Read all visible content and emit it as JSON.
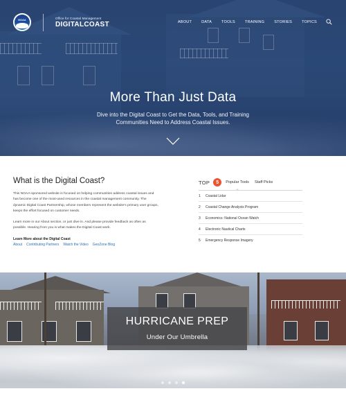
{
  "header": {
    "logo_text": "NOAA",
    "brand_sub": "Office for Coastal Management",
    "brand_title": "DIGITALCOAST",
    "nav": [
      "ABOUT",
      "DATA",
      "TOOLS",
      "TRAINING",
      "STORIES",
      "TOPICS"
    ],
    "search_icon": "search-icon"
  },
  "hero": {
    "title": "More Than Just Data",
    "subtitle": "Dive into the Digital Coast to Get the Data, Tools, and Training Communities Need to Address Coastal Issues.",
    "scroll_icon": "chevron-down-icon"
  },
  "intro": {
    "heading": "What is the Digital Coast?",
    "paragraph1": "This NOAA-sponsored website is focused on helping communities address coastal issues and has become one of the most-used resources in the coastal management community. The dynamic Digital Coast Partnership, whose members represent the website's primary user groups, keeps the effort focused on customer needs.",
    "paragraph2": "Learn more in our About section, or just dive in. And please provide feedback as often as possible. Hearing from you is what makes the Digital Coast work.",
    "learn_more_label": "Learn More about the Digital Coast",
    "links": [
      "About",
      "Contributing Partners",
      "Watch the Video",
      "GeoZone Blog"
    ]
  },
  "top_panel": {
    "top_label": "TOP",
    "badge": "5",
    "tabs": [
      "Popular Tools",
      "Staff Picks"
    ],
    "active_tab": "Popular Tools",
    "items": [
      {
        "num": "1",
        "label": "Coastal Lidar"
      },
      {
        "num": "2",
        "label": "Coastal Change Analysis Program"
      },
      {
        "num": "3",
        "label": "Economics: National Ocean Watch"
      },
      {
        "num": "4",
        "label": "Electronic Nautical Charts"
      },
      {
        "num": "5",
        "label": "Emergency Response Imagery"
      }
    ]
  },
  "feature": {
    "title": "HURRICANE PREP",
    "subtitle": "Under Our Umbrella",
    "slides": 4,
    "active_slide": 4
  },
  "colors": {
    "hero_overlay": "#2f4a78",
    "badge": "#e8552f",
    "link": "#2c6fb2",
    "feature_box": "#464648"
  }
}
